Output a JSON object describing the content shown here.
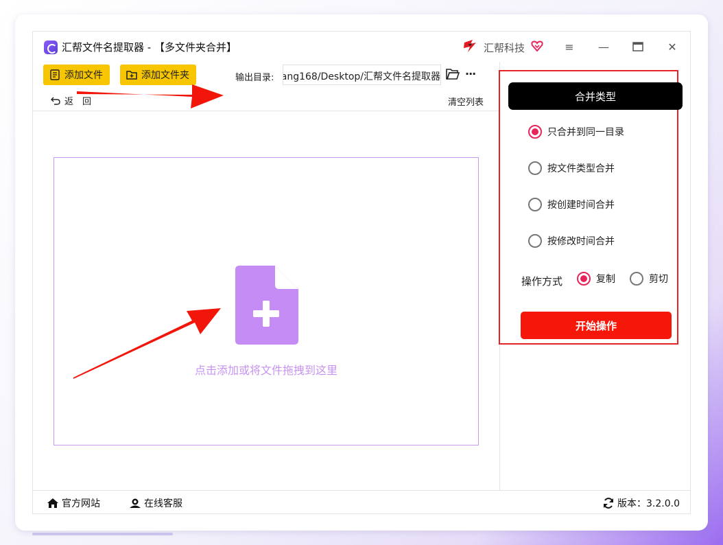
{
  "window": {
    "title": "汇帮文件名提取器 - 【多文件夹合并】",
    "brand": "汇帮科技",
    "controls": {
      "menu": "≡",
      "minimize": "—",
      "maximize": "▭",
      "close": "✕"
    }
  },
  "toolbar": {
    "add_file": "添加文件",
    "add_folder": "添加文件夹",
    "output_label": "输出目录:",
    "output_path": "ang168/Desktop/汇帮文件名提取器",
    "more": "···",
    "back": "返　回",
    "clear_list": "清空列表"
  },
  "dropzone": {
    "hint": "点击添加或将文件拖拽到这里"
  },
  "panel": {
    "header": "合并类型",
    "options": [
      {
        "label": "只合并到同一目录",
        "selected": true
      },
      {
        "label": "按文件类型合并",
        "selected": false
      },
      {
        "label": "按创建时间合并",
        "selected": false
      },
      {
        "label": "按修改时间合并",
        "selected": false
      }
    ],
    "operation_label": "操作方式",
    "operations": [
      {
        "label": "复制",
        "selected": true
      },
      {
        "label": "剪切",
        "selected": false
      }
    ],
    "start_button": "开始操作"
  },
  "status": {
    "website": "官方网站",
    "support": "在线客服",
    "version": "版本：3.2.0.0"
  },
  "colors": {
    "accent_yellow": "#f7c600",
    "start_red": "#f5170a",
    "radio_pink": "#e8245a",
    "dropzone_purple": "#c79bee",
    "annotation_red": "#e42424"
  }
}
